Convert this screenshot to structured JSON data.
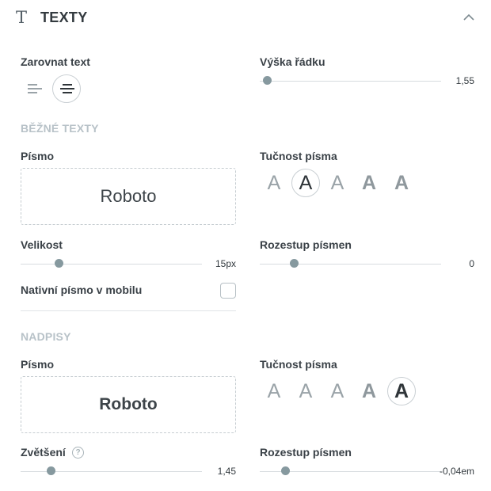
{
  "header": {
    "title": "TEXTY",
    "icon": "text-icon"
  },
  "align": {
    "label": "Zarovnat text",
    "options": [
      "align-left-icon",
      "align-center-icon"
    ],
    "selected": 1
  },
  "line_height": {
    "label": "Výška řádku",
    "value": "1,55",
    "level": 0.04
  },
  "body": {
    "section": "BĚŽNÉ TEXTY",
    "font_label": "Písmo",
    "font": "Roboto",
    "weight_label": "Tučnost písma",
    "weight_glyphs": [
      "A",
      "A",
      "A",
      "A",
      "A"
    ],
    "weight_selected": 1,
    "size_label": "Velikost",
    "size_value": "15px",
    "size_level": 0.21,
    "spacing_label": "Rozestup písmen",
    "spacing_value": "0",
    "spacing_level": 0.19,
    "native_label": "Nativní písmo v mobilu",
    "native_checked": false
  },
  "headings": {
    "section": "NADPISY",
    "font_label": "Písmo",
    "font": "Roboto",
    "weight_label": "Tučnost písma",
    "weight_glyphs": [
      "A",
      "A",
      "A",
      "A",
      "A"
    ],
    "weight_selected": 4,
    "scale_label": "Zvětšení",
    "scale_help": "?",
    "scale_value": "1,45",
    "scale_level": 0.17,
    "spacing_label": "Rozestup písmen",
    "spacing_value": "-0,04em",
    "spacing_level": 0.14
  },
  "colors": {
    "thumb": "#86999f",
    "section": "#b8c2c8",
    "text": "#333a3f"
  }
}
